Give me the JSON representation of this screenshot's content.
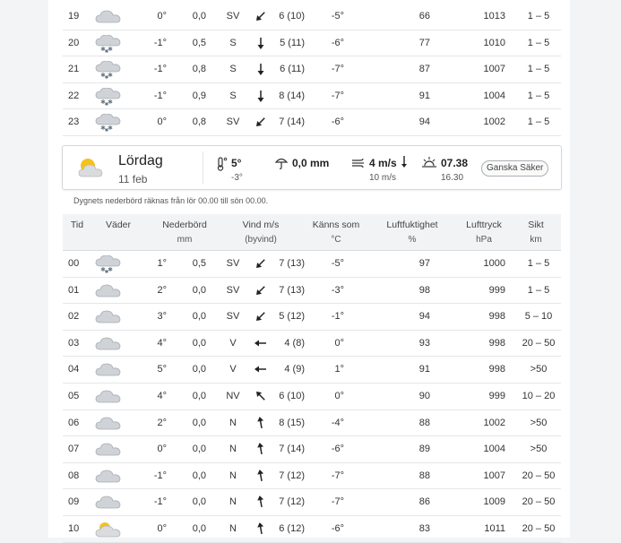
{
  "top_rows": [
    {
      "time": "19",
      "icon": "cloud-icon",
      "temp": "0°",
      "prec": "0,0",
      "dir": "SV",
      "wind": "6 (10)",
      "feels": "-5°",
      "humidity": "66",
      "pressure": "1013",
      "sikt": "1 – 5",
      "rot": -135
    },
    {
      "time": "20",
      "icon": "snow-cloud-icon",
      "temp": "-1°",
      "prec": "0,5",
      "dir": "S",
      "wind": "5 (11)",
      "feels": "-6°",
      "humidity": "77",
      "pressure": "1010",
      "sikt": "1 – 5",
      "rot": -180
    },
    {
      "time": "21",
      "icon": "snow-cloud-icon",
      "temp": "-1°",
      "prec": "0,8",
      "dir": "S",
      "wind": "6 (11)",
      "feels": "-7°",
      "humidity": "87",
      "pressure": "1007",
      "sikt": "1 – 5",
      "rot": -180
    },
    {
      "time": "22",
      "icon": "snow-cloud-icon",
      "temp": "-1°",
      "prec": "0,9",
      "dir": "S",
      "wind": "8 (14)",
      "feels": "-7°",
      "humidity": "91",
      "pressure": "1004",
      "sikt": "1 – 5",
      "rot": -180
    },
    {
      "time": "23",
      "icon": "snow-cloud-icon",
      "temp": "0°",
      "prec": "0,8",
      "dir": "SV",
      "wind": "7 (14)",
      "feels": "-6°",
      "humidity": "94",
      "pressure": "1002",
      "sikt": "1 – 5",
      "rot": -135
    }
  ],
  "day": {
    "name": "Lördag",
    "date": "11 feb",
    "temp_max": "5°",
    "temp_min": "-3°",
    "precip": "0,0 mm",
    "wind": "4 m/s",
    "gust": "10 m/s",
    "sunrise": "07.38",
    "sunset": "16.30",
    "certainty": "Ganska Säker"
  },
  "note": "Dygnets nederbörd räknas från lör 00.00 till sön 00.00.",
  "headers": {
    "tid": "Tid",
    "vader": "Väder",
    "nederbord": "Nederbörd",
    "nederbord_unit": "mm",
    "vind": "Vind m/s",
    "vind_unit": "(byvind)",
    "kanns": "Känns som",
    "kanns_unit": "°C",
    "luftfukt": "Luftfuktighet",
    "luftfukt_unit": "%",
    "lufttryck": "Lufttryck",
    "lufttryck_unit": "hPa",
    "sikt": "Sikt",
    "sikt_unit": "km"
  },
  "rows": [
    {
      "time": "00",
      "icon": "snow-cloud-icon",
      "temp": "1°",
      "prec": "0,5",
      "dir": "SV",
      "wind": "7 (13)",
      "feels": "-5°",
      "humidity": "97",
      "pressure": "1000",
      "sikt": "1 – 5",
      "rot": -135
    },
    {
      "time": "01",
      "icon": "cloud-icon",
      "temp": "2°",
      "prec": "0,0",
      "dir": "SV",
      "wind": "7 (13)",
      "feels": "-3°",
      "humidity": "98",
      "pressure": "999",
      "sikt": "1 – 5",
      "rot": -135
    },
    {
      "time": "02",
      "icon": "cloud-icon",
      "temp": "3°",
      "prec": "0,0",
      "dir": "SV",
      "wind": "5 (12)",
      "feels": "-1°",
      "humidity": "94",
      "pressure": "998",
      "sikt": "5 – 10",
      "rot": -135
    },
    {
      "time": "03",
      "icon": "cloud-icon",
      "temp": "4°",
      "prec": "0,0",
      "dir": "V",
      "wind": "4 (8)",
      "feels": "0°",
      "humidity": "93",
      "pressure": "998",
      "sikt": "20 – 50",
      "rot": -90
    },
    {
      "time": "04",
      "icon": "cloud-icon",
      "temp": "5°",
      "prec": "0,0",
      "dir": "V",
      "wind": "4 (9)",
      "feels": "1°",
      "humidity": "91",
      "pressure": "998",
      "sikt": ">50",
      "rot": -90
    },
    {
      "time": "05",
      "icon": "cloud-icon",
      "temp": "4°",
      "prec": "0,0",
      "dir": "NV",
      "wind": "6 (10)",
      "feels": "0°",
      "humidity": "90",
      "pressure": "999",
      "sikt": "10 – 20",
      "rot": -45
    },
    {
      "time": "06",
      "icon": "cloud-icon",
      "temp": "2°",
      "prec": "0,0",
      "dir": "N",
      "wind": "8 (15)",
      "feels": "-4°",
      "humidity": "88",
      "pressure": "1002",
      "sikt": ">50",
      "rot": -10
    },
    {
      "time": "07",
      "icon": "cloud-icon",
      "temp": "0°",
      "prec": "0,0",
      "dir": "N",
      "wind": "7 (14)",
      "feels": "-6°",
      "humidity": "89",
      "pressure": "1004",
      "sikt": ">50",
      "rot": -10
    },
    {
      "time": "08",
      "icon": "cloud-icon",
      "temp": "-1°",
      "prec": "0,0",
      "dir": "N",
      "wind": "7 (12)",
      "feels": "-7°",
      "humidity": "88",
      "pressure": "1007",
      "sikt": "20 – 50",
      "rot": -10
    },
    {
      "time": "09",
      "icon": "cloud-icon",
      "temp": "-1°",
      "prec": "0,0",
      "dir": "N",
      "wind": "7 (12)",
      "feels": "-7°",
      "humidity": "86",
      "pressure": "1009",
      "sikt": "20 – 50",
      "rot": -10
    },
    {
      "time": "10",
      "icon": "sun-cloud-icon",
      "temp": "0°",
      "prec": "0,0",
      "dir": "N",
      "wind": "6 (12)",
      "feels": "-6°",
      "humidity": "83",
      "pressure": "1011",
      "sikt": "20 – 50",
      "rot": -10
    }
  ]
}
